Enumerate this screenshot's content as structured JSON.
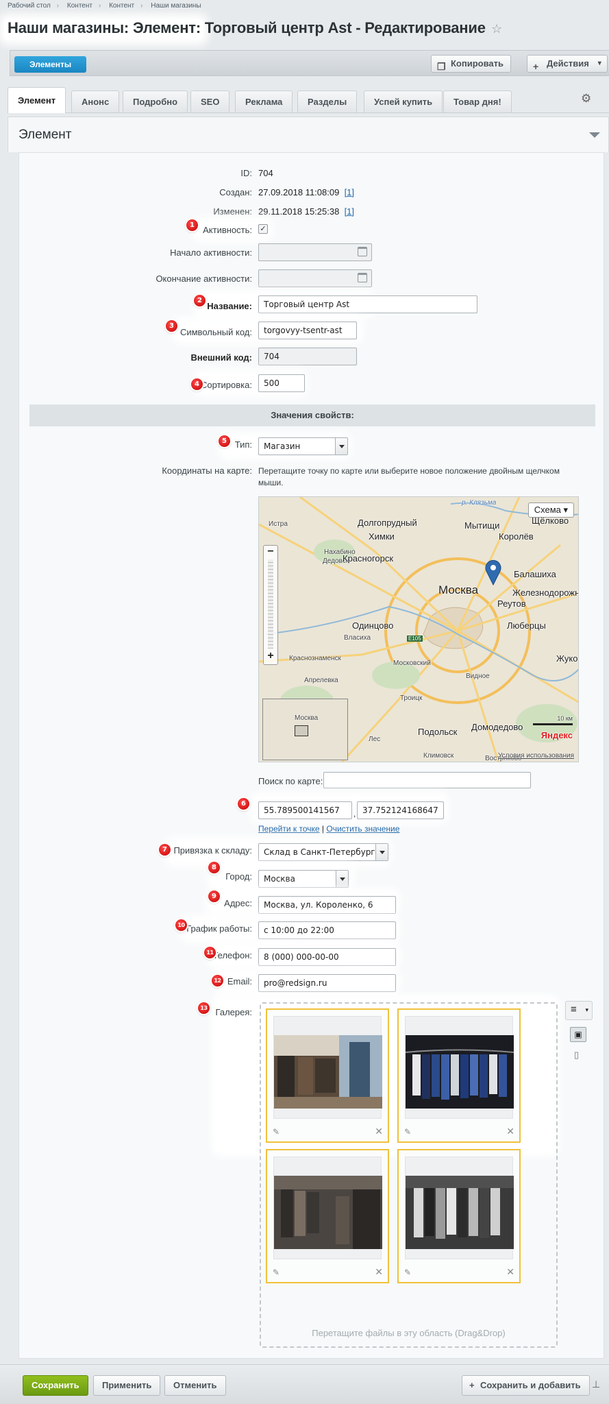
{
  "breadcrumbs": [
    "Рабочий стол",
    "Контент",
    "Контент",
    "Наши магазины"
  ],
  "page_title": "Наши магазины: Элемент: Торговый центр Ast - Редактирование",
  "toolbar": {
    "elements": "Элементы",
    "copy": "Копировать",
    "actions": "Действия"
  },
  "tabs": [
    "Элемент",
    "Анонс",
    "Подробно",
    "SEO",
    "Реклама",
    "Разделы",
    "Успей купить",
    "Товар дня!"
  ],
  "section_title": "Элемент",
  "fields": {
    "id": {
      "label": "ID:",
      "value": "704"
    },
    "created": {
      "label": "Создан:",
      "value": "27.09.2018 11:08:09",
      "link": "[1]"
    },
    "modified": {
      "label": "Изменен:",
      "value": "29.11.2018 15:25:38",
      "link": "[1]"
    },
    "active": {
      "label": "Активность:",
      "checked": true
    },
    "active_from": {
      "label": "Начало активности:",
      "value": ""
    },
    "active_to": {
      "label": "Окончание активности:",
      "value": ""
    },
    "name": {
      "label": "Название:",
      "value": "Торговый центр Ast"
    },
    "code": {
      "label": "Символьный код:",
      "value": "torgovyy-tsentr-ast"
    },
    "xml_id": {
      "label": "Внешний код:",
      "value": "704"
    },
    "sort": {
      "label": "Сортировка:",
      "value": "500"
    }
  },
  "props_title": "Значения свойств:",
  "props": {
    "type": {
      "label": "Тип:",
      "value": "Магазин"
    },
    "coords": {
      "label": "Координаты на карте:",
      "hint": "Перетащите точку по карте или выберите новое положение двойным щелчком мыши."
    },
    "map_search": {
      "label": "Поиск по карте:",
      "value": ""
    },
    "lat": "55.789500141567",
    "lng": "37.752124168647",
    "coord_sep": ",",
    "goto": "Перейти к точке",
    "link_sep": "|",
    "clear": "Очистить значение",
    "store": {
      "label": "Привязка к складу:",
      "value": "Склад в Санкт-Петербурге"
    },
    "city": {
      "label": "Город:",
      "value": "Москва"
    },
    "address": {
      "label": "Адрес:",
      "value": "Москва, ул. Короленко, 6"
    },
    "schedule": {
      "label": "График работы:",
      "value": "с 10:00 до 22:00"
    },
    "phone": {
      "label": "Телефон:",
      "value": "8 (000) 000-00-00"
    },
    "email": {
      "label": "Email:",
      "value": "pro@redsign.ru"
    },
    "gallery": {
      "label": "Галерея:",
      "drop_text": "Перетащите файлы в эту область (Drag&Drop)"
    }
  },
  "map": {
    "mode": "Схема",
    "cities": [
      "Истра",
      "Долгопрудный",
      "Мытищи",
      "Щёлково",
      "Химки",
      "Королёв",
      "Нахабино",
      "Дедовск",
      "Красногорск",
      "Балашиха",
      "Москва",
      "Железнодорожный",
      "Реутов",
      "Одинцово",
      "Власиха",
      "Люберцы",
      "Краснознаменск",
      "Московский",
      "Жуко",
      "Апрелевка",
      "Видное",
      "Троицк",
      "Домодедово",
      "Подольск",
      "Лес",
      "Климовск",
      "Востряково",
      "Москва"
    ],
    "scale": "10 км",
    "brand": "Яндекс",
    "terms": "Условия использования",
    "road": "E105",
    "river": "р. Клязьма"
  },
  "badges": [
    "1",
    "2",
    "3",
    "4",
    "5",
    "6",
    "7",
    "8",
    "9",
    "10",
    "11",
    "12",
    "13"
  ],
  "footer": {
    "save": "Сохранить",
    "apply": "Применить",
    "cancel": "Отменить",
    "save_add": "Сохранить и добавить"
  },
  "colors": {
    "accent": "#1a86c2",
    "save": "#7aa816",
    "highlight": "#f0c13c",
    "badge": "#d40000"
  }
}
